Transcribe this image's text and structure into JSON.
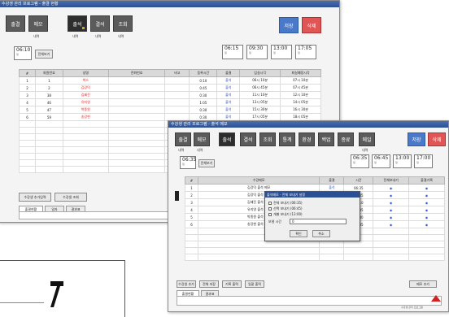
{
  "left_window": {
    "title": "수강생 관리 프로그램 - 출결 현황",
    "toolbar": [
      {
        "label": "출결",
        "sub": ""
      },
      {
        "label": "메모",
        "sub": "내역"
      },
      {
        "label": "출석",
        "sub": "내역"
      },
      {
        "label": "결석",
        "sub": "내역"
      },
      {
        "label": "조회",
        "sub": "내역"
      }
    ],
    "save_label": "저장",
    "delete_label": "삭제",
    "date_box": {
      "time": "06:10",
      "sub": "일"
    },
    "filter_label": "전체보기",
    "time_slots": [
      {
        "time": "06:15",
        "sub": "일"
      },
      {
        "time": "09:30",
        "sub": "일"
      },
      {
        "time": "13:00",
        "sub": "일"
      },
      {
        "time": "17:05",
        "sub": "일"
      }
    ],
    "headers": [
      "#",
      "회원번호",
      "성명",
      "전화번호",
      "비고",
      "등록시간",
      "출결",
      "입실시각",
      "퇴실예정시각"
    ],
    "rows": [
      [
        "1",
        "1",
        "박스",
        "",
        "",
        "0:10",
        "출석",
        "06시 10분",
        "07시 10분"
      ],
      [
        "2",
        "2",
        "김강덕",
        "",
        "",
        "0:45",
        "출석",
        "06시 45분",
        "07시 45분"
      ],
      [
        "3",
        "38",
        "김혜진",
        "",
        "",
        "0:30",
        "출석",
        "11시 10분",
        "12시 10분"
      ],
      [
        "4",
        "46",
        "유지영",
        "",
        "",
        "1:05",
        "출석",
        "13시 05분",
        "14시 05분"
      ],
      [
        "5",
        "47",
        "박종원",
        "",
        "",
        "0:30",
        "출석",
        "15시 30분",
        "16시 30분"
      ],
      [
        "6",
        "59",
        "송강현",
        "",
        "",
        "0:30",
        "출석",
        "17시 05분",
        "18시 05분"
      ]
    ],
    "bottom_buttons": [
      "수강생 추가입력",
      "수강생 조회"
    ],
    "tabs": [
      "출결현황",
      "일자",
      "결과표"
    ]
  },
  "right_window": {
    "title": "수강생 관리 프로그램 - 출석 메모",
    "toolbar": [
      {
        "label": "출결",
        "sub": "내역"
      },
      {
        "label": "메모",
        "sub": "내역"
      },
      {
        "label": "출석",
        "sub": ""
      },
      {
        "label": "결석",
        "sub": ""
      },
      {
        "label": "조회",
        "sub": ""
      },
      {
        "label": "통계",
        "sub": ""
      },
      {
        "label": "환경",
        "sub": ""
      },
      {
        "label": "백업",
        "sub": ""
      },
      {
        "label": "종료",
        "sub": ""
      },
      {
        "label": "메일",
        "sub": "내역"
      }
    ],
    "save_label": "저장",
    "delete_label": "삭제",
    "date_box": {
      "time": "06:35",
      "sub": "일"
    },
    "filter_label": "전체보기",
    "time_slots": [
      {
        "time": "06:35",
        "sub": "일"
      },
      {
        "time": "06:45",
        "sub": "일"
      },
      {
        "time": "13:00",
        "sub": "일"
      },
      {
        "time": "17:00",
        "sub": "일"
      }
    ],
    "headers": [
      "#",
      "수강메모",
      "출결",
      "시간",
      "전체보내기",
      "출결기록"
    ],
    "rows": [
      [
        "1",
        "김강덕 출석 메모",
        "출석",
        "06:35",
        "◉",
        "◉"
      ],
      [
        "2",
        "김강덕 출석 메모",
        "출석",
        "06:45",
        "◉",
        "◉"
      ],
      [
        "3",
        "김혜진 출석 메모",
        "출석",
        "11:10",
        "◉",
        "◉"
      ],
      [
        "4",
        "유지영 출석 메모",
        "출석",
        "13:05",
        "◉",
        "◉"
      ],
      [
        "5",
        "박종원 출석 메모",
        "출석",
        "15:30",
        "◉",
        "◉"
      ],
      [
        "6",
        "송강현 출석 메모",
        "출석",
        "17:05",
        "◉",
        "◉"
      ]
    ],
    "dialog": {
      "title": "출석메모 - 전체 보내기 설정",
      "options": [
        "전체 보내기 (06:35)",
        "선택 보내기 (06:45)",
        "개별 보내기 (13:00)"
      ],
      "field_label": "보낼 시간",
      "field_value": "0",
      "ok_label": "확인",
      "cancel_label": "취소"
    },
    "bottom_buttons": [
      "수강생 추가",
      "전체 저장",
      "기록 출력",
      "일괄 출력"
    ],
    "right_button": "메모 추가",
    "tabs": [
      "출결현황",
      "결과표"
    ],
    "status": "수강생 관리 프로그램"
  },
  "colors": {
    "toolbar_button": "#5b5b5b",
    "save": "#4a79c9",
    "delete": "#e05656",
    "name_red": "#d42020",
    "status_blue": "#2b4fc9"
  }
}
